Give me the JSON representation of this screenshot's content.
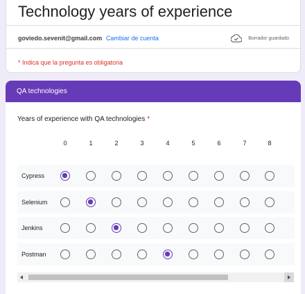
{
  "form": {
    "title": "Technology years of experience",
    "account_email": "goviedo.sevenit@gmail.com",
    "switch_account": "Cambiar de cuenta",
    "draft_status": "Borrador guardado",
    "required_note": "* Indica que la pregunta es obligatoria"
  },
  "section": {
    "title": "QA technologies"
  },
  "question": {
    "text": "Years of experience with QA technologies",
    "required_mark": "*",
    "columns": [
      "0",
      "1",
      "2",
      "3",
      "4",
      "5",
      "6",
      "7",
      "8"
    ],
    "rows": [
      {
        "label": "Cypress",
        "selected": "0"
      },
      {
        "label": "Selenium",
        "selected": "1"
      },
      {
        "label": "Jenkins",
        "selected": "2"
      },
      {
        "label": "Postman",
        "selected": "4"
      }
    ]
  },
  "colors": {
    "accent": "#673ab7",
    "background": "#f0ebf8",
    "required": "#d93025",
    "link": "#1a73e8"
  },
  "icons": {
    "draft": "cloud-check-icon"
  }
}
